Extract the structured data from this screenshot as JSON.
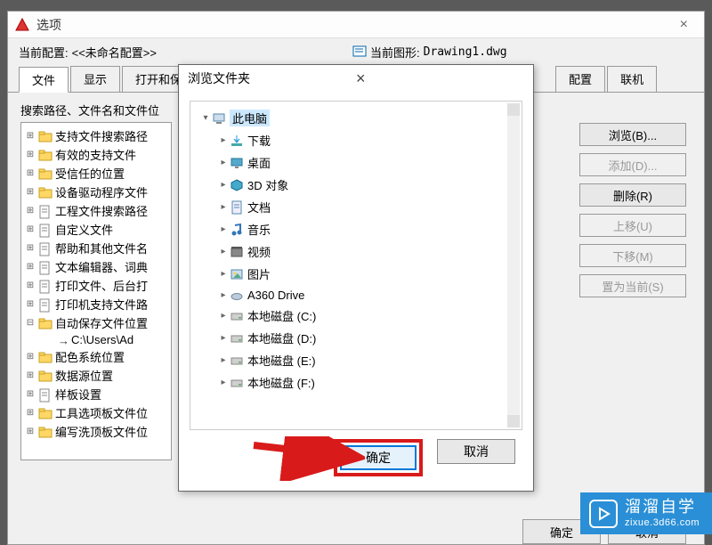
{
  "main": {
    "title": "选项",
    "close": "×",
    "config_label": "当前配置:",
    "config_value": "<<未命名配置>>",
    "drawing_label": "当前图形:",
    "drawing_value": "Drawing1.dwg"
  },
  "tabs": [
    "文件",
    "显示",
    "打开和保存",
    "配置",
    "联机"
  ],
  "left": {
    "section_label": "搜索路径、文件名和文件位",
    "tree": [
      {
        "label": "支持文件搜索路径",
        "exp": "⊞",
        "icon": "folder"
      },
      {
        "label": "有效的支持文件",
        "exp": "⊞",
        "icon": "folder"
      },
      {
        "label": "受信任的位置",
        "exp": "⊞",
        "icon": "folder"
      },
      {
        "label": "设备驱动程序文件",
        "exp": "⊞",
        "icon": "folder"
      },
      {
        "label": "工程文件搜索路径",
        "exp": "⊞",
        "icon": "file"
      },
      {
        "label": "自定义文件",
        "exp": "⊞",
        "icon": "file"
      },
      {
        "label": "帮助和其他文件名",
        "exp": "⊞",
        "icon": "file"
      },
      {
        "label": "文本编辑器、词典",
        "exp": "⊞",
        "icon": "file"
      },
      {
        "label": "打印文件、后台打",
        "exp": "⊞",
        "icon": "file"
      },
      {
        "label": "打印机支持文件路",
        "exp": "⊞",
        "icon": "file"
      },
      {
        "label": "自动保存文件位置",
        "exp": "⊟",
        "icon": "folder",
        "expanded": true
      },
      {
        "label": "C:\\Users\\Ad",
        "child": true,
        "icon": "arrow"
      },
      {
        "label": "配色系统位置",
        "exp": "⊞",
        "icon": "folder"
      },
      {
        "label": "数据源位置",
        "exp": "⊞",
        "icon": "folder"
      },
      {
        "label": "样板设置",
        "exp": "⊞",
        "icon": "file"
      },
      {
        "label": "工具选项板文件位",
        "exp": "⊞",
        "icon": "folder"
      },
      {
        "label": "编写洗顶板文件位",
        "exp": "⊞",
        "icon": "folder"
      }
    ]
  },
  "right_buttons": [
    {
      "label": "浏览(B)...",
      "enabled": true
    },
    {
      "label": "添加(D)...",
      "enabled": false
    },
    {
      "label": "删除(R)",
      "enabled": true
    },
    {
      "label": "上移(U)",
      "enabled": false
    },
    {
      "label": "下移(M)",
      "enabled": false
    },
    {
      "label": "置为当前(S)",
      "enabled": false
    }
  ],
  "bottom_buttons": {
    "ok": "确定",
    "cancel": "取消"
  },
  "modal": {
    "title": "浏览文件夹",
    "close": "×",
    "root": "此电脑",
    "items": [
      {
        "label": "下载",
        "icon": "download"
      },
      {
        "label": "桌面",
        "icon": "desktop"
      },
      {
        "label": "3D 对象",
        "icon": "3d"
      },
      {
        "label": "文档",
        "icon": "doc"
      },
      {
        "label": "音乐",
        "icon": "music"
      },
      {
        "label": "视频",
        "icon": "video"
      },
      {
        "label": "图片",
        "icon": "pic"
      },
      {
        "label": "A360 Drive",
        "icon": "a360"
      },
      {
        "label": "本地磁盘 (C:)",
        "icon": "disk"
      },
      {
        "label": "本地磁盘 (D:)",
        "icon": "disk"
      },
      {
        "label": "本地磁盘 (E:)",
        "icon": "disk"
      },
      {
        "label": "本地磁盘 (F:)",
        "icon": "disk"
      }
    ],
    "ok": "确定",
    "cancel": "取消"
  },
  "watermark": {
    "title": "溜溜自学",
    "sub": "zixue.3d66.com"
  }
}
